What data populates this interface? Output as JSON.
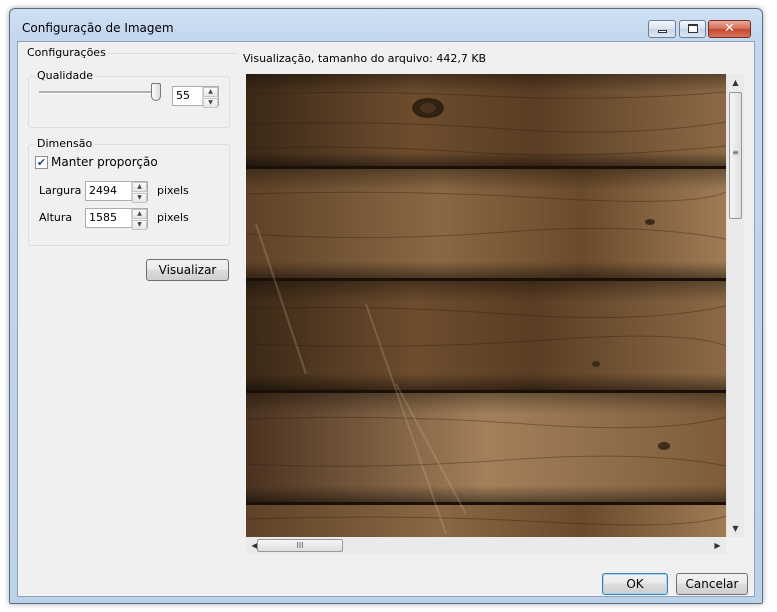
{
  "window": {
    "title": "Configuração de Imagem",
    "buttons": {
      "minimize_icon": "minimize-icon",
      "maximize_icon": "maximize-icon",
      "close_glyph": "✕"
    }
  },
  "settings": {
    "group_label": "Configurações",
    "quality": {
      "label": "Qualidade",
      "slider_level": 0.55,
      "value": "55"
    },
    "dimension": {
      "label": "Dimensão",
      "keep_ratio_label": "Manter proporção",
      "keep_ratio_checked": true,
      "width_label": "Largura",
      "width_value": "2494",
      "width_unit": "pixels",
      "height_label": "Altura",
      "height_value": "1585",
      "height_unit": "pixels"
    },
    "preview_button": "Visualizar"
  },
  "preview": {
    "caption": "Visualização, tamanho do arquivo: 442,7 KB",
    "image_description_icon": "wood-planks-image"
  },
  "scrollbars": {
    "up_glyph": "▲",
    "down_glyph": "▼",
    "left_glyph": "◀",
    "right_glyph": "▶",
    "grip": "≡",
    "hgrip": "III"
  },
  "footer": {
    "ok_label": "OK",
    "cancel_label": "Cancelar"
  },
  "colors": {
    "wood_dark": "#2e1f12",
    "wood_mid": "#6b4a2c",
    "wood_light": "#a8825a",
    "titlebar": "#c3d7ee"
  }
}
